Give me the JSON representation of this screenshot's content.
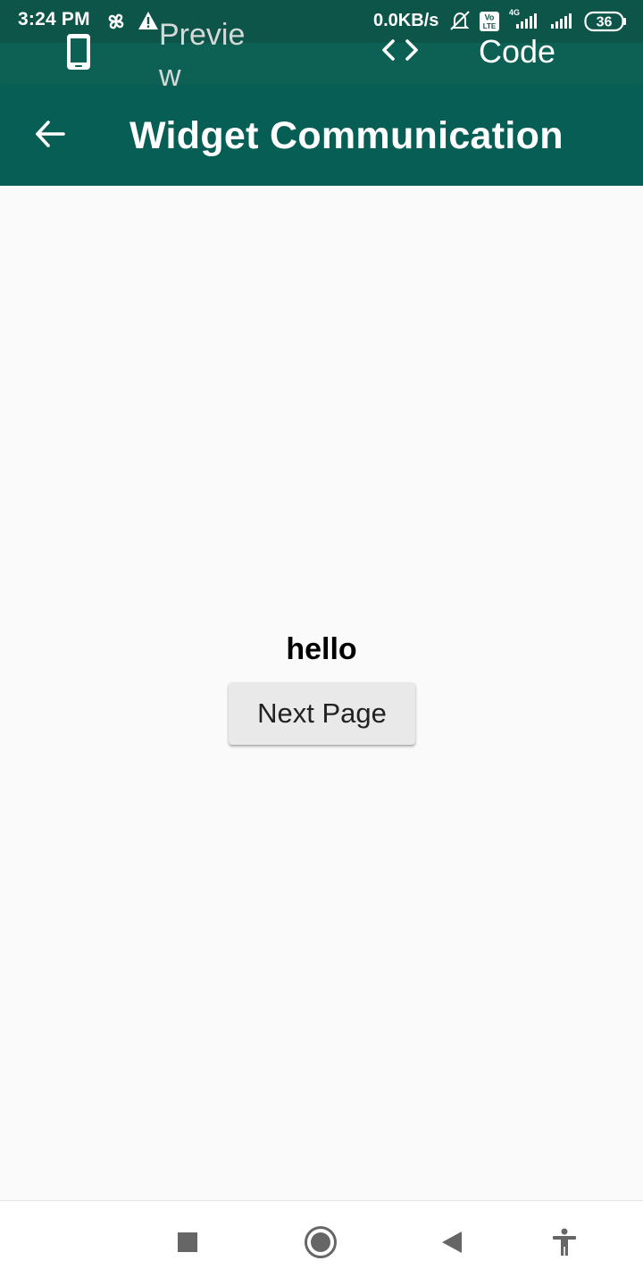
{
  "status_bar": {
    "time": "3:24 PM",
    "network_speed": "0.0KB/s",
    "network_type": "4G",
    "volte_badge": "Vo LTE",
    "battery_level": "36",
    "icons": [
      "pinwheel-icon",
      "warning-icon",
      "bell-off-icon",
      "volte-icon",
      "signal-4g-icon",
      "signal-icon",
      "battery-icon"
    ]
  },
  "tabs": {
    "preview_label": "Preview",
    "code_label": "Code",
    "preview_icon": "phone-icon",
    "code_icon": "code-brackets-icon"
  },
  "app_bar": {
    "title": "Widget Communication",
    "back_icon": "arrow-left-icon"
  },
  "main": {
    "text": "hello",
    "button_label": "Next Page"
  },
  "nav_bar": {
    "buttons": [
      "recents-square-icon",
      "home-circle-icon",
      "back-triangle-icon",
      "accessibility-icon"
    ]
  },
  "colors": {
    "status_bar": "#0d5449",
    "tab_bar": "#0d6154",
    "app_bar": "#075e54",
    "background": "#fafafa",
    "button": "#e9e9e9"
  }
}
